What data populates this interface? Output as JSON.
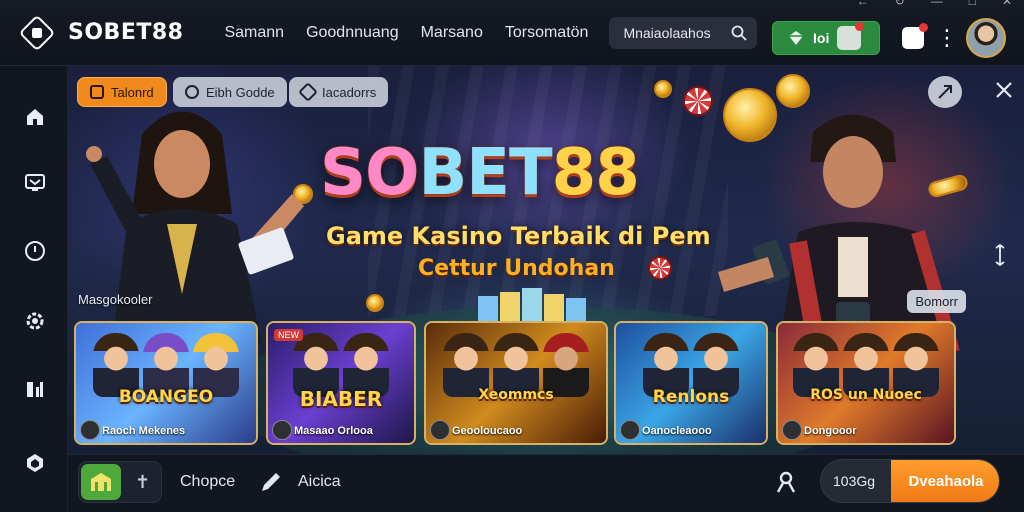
{
  "window": {
    "controls": [
      "back-icon",
      "refresh-icon",
      "minimize-icon",
      "maximize-icon",
      "close-icon"
    ]
  },
  "header": {
    "brand": "SOBET88",
    "nav": [
      "Samann",
      "Goodnnuang",
      "Marsano",
      "Torsomatön"
    ],
    "search": {
      "value": "Mnaiaolaahos"
    },
    "wallet_label": "Ioi"
  },
  "sidebar": {
    "items": [
      "home-icon",
      "monitor-icon",
      "clock-icon",
      "settings-icon",
      "chart-icon",
      "shield-icon"
    ]
  },
  "banner": {
    "chips": [
      {
        "label": "Talonrd",
        "active": true
      },
      {
        "label": "Eibh Godde",
        "active": false
      },
      {
        "label": "Iacadorrs",
        "active": false
      }
    ],
    "logo_parts": [
      "SO",
      "BET",
      "88"
    ],
    "subtitle_1": "Game Kasino Terbaik di Pem",
    "subtitle_2": "Cettur Undohan",
    "section_left": "Masgokooler",
    "section_right": "Bomorr",
    "cards": [
      {
        "title": "BOANGEO",
        "subtitle": "Raoch Mekenes",
        "tag": ""
      },
      {
        "title": "BIABER",
        "subtitle": "Masaao Orlooa",
        "tag": "NEW"
      },
      {
        "title": "Xeommcs",
        "subtitle": "Geooloucaoo",
        "tag": ""
      },
      {
        "title": "Renlons",
        "subtitle": "Oanocleaooo",
        "tag": ""
      },
      {
        "title": "ROS un Nuoec",
        "subtitle": "Dongooor",
        "tag": ""
      }
    ]
  },
  "footer": {
    "tab_1": "Chopce",
    "tab_2": "Aicica",
    "balance": "103Gg",
    "deposit_label": "Dveahaola"
  },
  "colors": {
    "accent": "#f08a1c",
    "wallet": "#2b8a3e",
    "gold": "#ffd24a"
  }
}
